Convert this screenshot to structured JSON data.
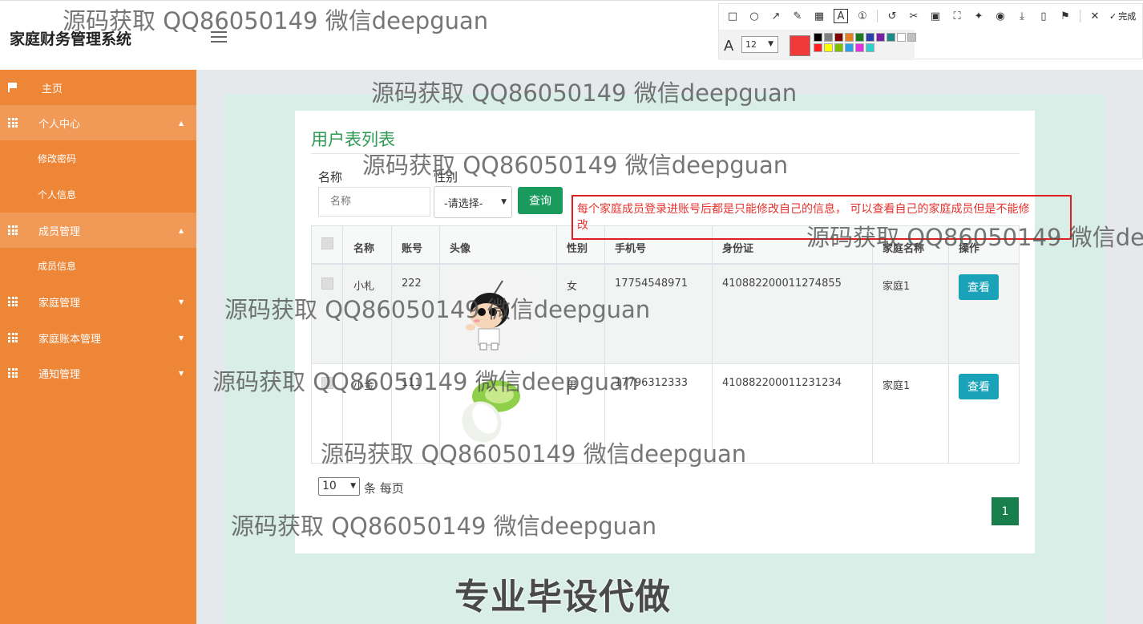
{
  "app": {
    "title": "家庭财务管理系统",
    "avatar_text": "80x80"
  },
  "annotation_toolbar": {
    "font_size": "12",
    "current_color": "#f03a3a",
    "palette": [
      "#000000",
      "#808080",
      "#800000",
      "#e67e22",
      "#1e7a1e",
      "#2b3fa8",
      "#7a1ea8",
      "#1f8a8a",
      "#ffffff",
      "#c0c0c0",
      "#ff2020",
      "#ffff00",
      "#80c000",
      "#2aa0e8",
      "#e030e0",
      "#30d0d0"
    ],
    "done_label": "完成"
  },
  "sidebar": {
    "items": [
      {
        "label": "主页"
      },
      {
        "label": "个人中心"
      },
      {
        "label": "修改密码"
      },
      {
        "label": "个人信息"
      },
      {
        "label": "成员管理"
      },
      {
        "label": "成员信息"
      },
      {
        "label": "家庭管理"
      },
      {
        "label": "家庭账本管理"
      },
      {
        "label": "通知管理"
      }
    ]
  },
  "main": {
    "title": "用户表列表",
    "search": {
      "name_label": "名称",
      "name_placeholder": "名称",
      "gender_label": "性别",
      "gender_selected": "-请选择-",
      "query_label": "查询"
    },
    "table": {
      "columns": [
        "名称",
        "账号",
        "头像",
        "性别",
        "手机号",
        "身份证",
        "家庭名称",
        "操作"
      ],
      "rows": [
        {
          "name": "小札",
          "account": "222",
          "gender": "女",
          "phone": "17754548971",
          "id_card": "410882200011274855",
          "family": "家庭1",
          "action": "查看"
        },
        {
          "name": "小金",
          "account": "111",
          "gender": "男",
          "phone": "17796312333",
          "id_card": "410882200011231234",
          "family": "家庭1",
          "action": "查看"
        }
      ]
    },
    "pagination": {
      "page_size": "10",
      "per_page_label": "条 每页",
      "current_page": "1"
    }
  },
  "annotation_note": "每个家庭成员登录进账号后都是只能修改自己的信息， 可以查看自己的家庭成员但是不能修改",
  "watermark": "源码获取 QQ86050149 微信deepguan",
  "slogan": "专业毕设代做"
}
